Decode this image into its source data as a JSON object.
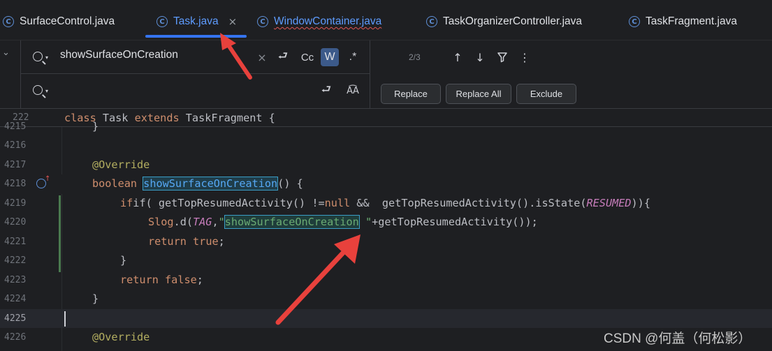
{
  "tabs": [
    {
      "label": "SurfaceControl.java"
    },
    {
      "label": "Task.java"
    },
    {
      "label": "WindowContainer.java"
    },
    {
      "label": "TaskOrganizerController.java"
    },
    {
      "label": "TaskFragment.java"
    }
  ],
  "tab_icon_glyph": "C",
  "close_glyph": "×",
  "find": {
    "search_text": "showSurfaceOnCreation",
    "replace_text": "",
    "match_count": "2/3",
    "case_label": "Cc",
    "word_label": "W",
    "regex_label": ".*",
    "buttons": {
      "replace": "Replace",
      "replace_all": "Replace All",
      "exclude": "Exclude"
    }
  },
  "sticky_line": {
    "number": "222",
    "class_kw": "class",
    "name": "Task",
    "extends_kw": "extends",
    "parent": "TaskFragment",
    "brace": "{"
  },
  "lines": [
    {
      "num": "4215",
      "code": "}"
    },
    {
      "num": "4216",
      "code": ""
    },
    {
      "num": "4217",
      "ann": "@Override"
    },
    {
      "num": "4218",
      "kw": "boolean",
      "fn": "showSurfaceOnCreation",
      "rest": "() {"
    },
    {
      "num": "4219",
      "p1": "if( getTopResumedActivity() !=",
      "kw": "null",
      "p2": " &&  getTopResumedActivity().isState(",
      "const": "RESUMED",
      "p3": ")){"
    },
    {
      "num": "4220",
      "cls": "Slog",
      "p1": ".d(",
      "const": "TAG",
      "p2": ",",
      "str1": "\"",
      "match": "showSurfaceOnCreation",
      "str2": " \"",
      "p3": "+getTopResumedActivity());"
    },
    {
      "num": "4221",
      "kw": "return",
      "kw2": "true",
      "rest": ";"
    },
    {
      "num": "4222",
      "code": "}"
    },
    {
      "num": "4223",
      "kw": "return",
      "kw2": "false",
      "rest": ";"
    },
    {
      "num": "4224",
      "code": "}"
    },
    {
      "num": "4225",
      "code": ""
    },
    {
      "num": "4226",
      "ann": "@Override"
    }
  ],
  "watermark": "CSDN @何盖（何松影）",
  "colors": {
    "accent": "#3574f0",
    "arrow": "#e8413c",
    "keyword": "#cf8e6d",
    "function": "#56a8f5",
    "string": "#6aab73",
    "annotation": "#b3ae60"
  }
}
